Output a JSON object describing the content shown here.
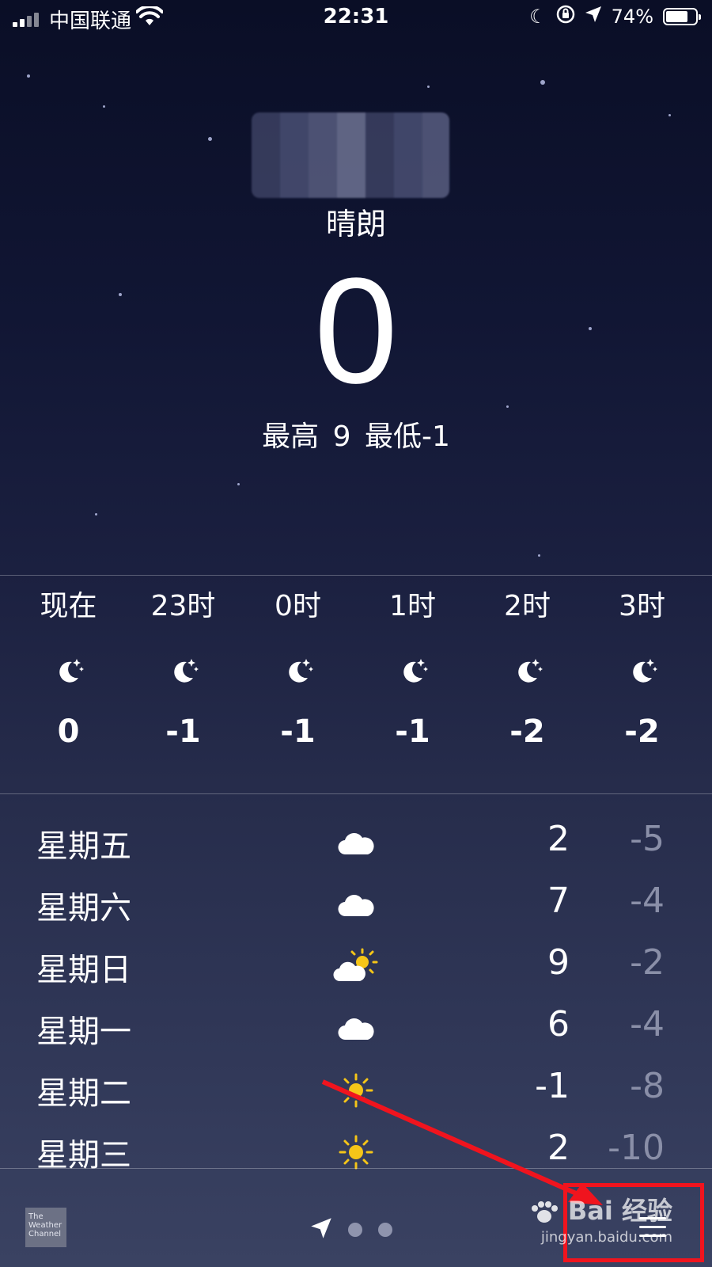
{
  "status_bar": {
    "carrier": "中国联通",
    "time": "22:31",
    "battery": "74%",
    "battery_level": 0.74
  },
  "current": {
    "condition": "晴朗",
    "temperature": "0",
    "high_low": "最高 9 最低-1"
  },
  "hourly": [
    {
      "time": "现在",
      "icon": "moon-star-icon",
      "temp": "0"
    },
    {
      "time": "23时",
      "icon": "moon-star-icon",
      "temp": "-1"
    },
    {
      "time": "0时",
      "icon": "moon-star-icon",
      "temp": "-1"
    },
    {
      "time": "1时",
      "icon": "moon-star-icon",
      "temp": "-1"
    },
    {
      "time": "2时",
      "icon": "moon-star-icon",
      "temp": "-2"
    },
    {
      "time": "3时",
      "icon": "moon-star-icon",
      "temp": "-2"
    }
  ],
  "daily": [
    {
      "day": "星期五",
      "icon": "cloud-icon",
      "high": "2",
      "low": "-5"
    },
    {
      "day": "星期六",
      "icon": "cloud-icon",
      "high": "7",
      "low": "-4"
    },
    {
      "day": "星期日",
      "icon": "partly-sunny-icon",
      "high": "9",
      "low": "-2"
    },
    {
      "day": "星期一",
      "icon": "cloud-icon",
      "high": "6",
      "low": "-4"
    },
    {
      "day": "星期二",
      "icon": "sun-icon",
      "high": "-1",
      "low": "-8"
    },
    {
      "day": "星期三",
      "icon": "sun-icon",
      "high": "2",
      "low": "-10"
    }
  ],
  "bottom_bar": {
    "provider_logo": "The Weather Channel",
    "pager_icon": "location-arrow-icon",
    "menu_icon": "list-icon"
  },
  "watermark": {
    "brand": "Bai 经验",
    "url": "jingyan.baidu.com"
  },
  "colors": {
    "annotation": "#f0141e",
    "low_temp": "#8a8fa8",
    "sun": "#f5c518"
  }
}
